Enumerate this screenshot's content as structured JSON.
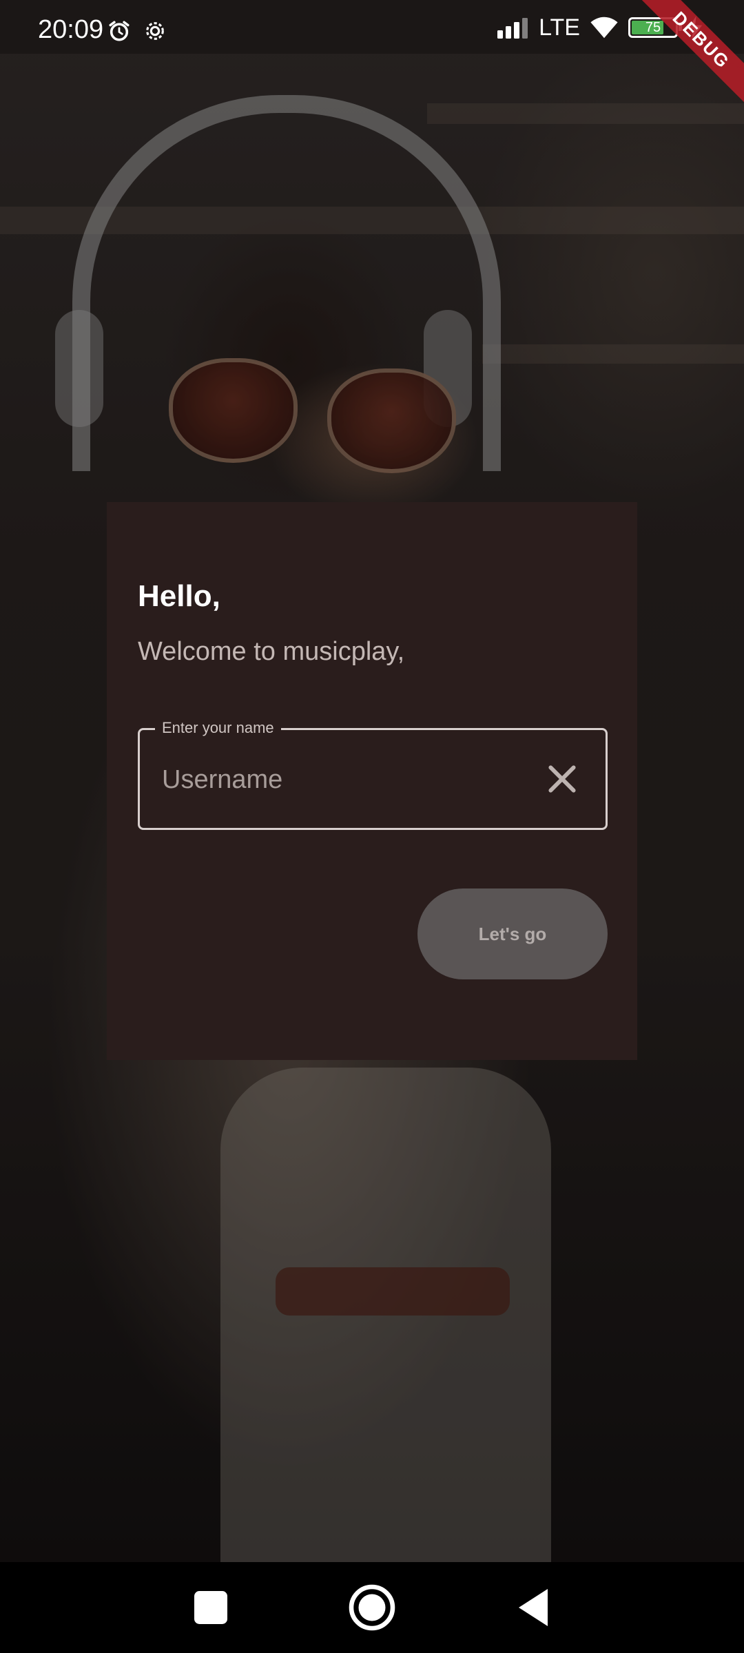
{
  "status_bar": {
    "time": "20:09",
    "network": "LTE",
    "battery_percent": "75",
    "battery_level": 0.75,
    "icons": [
      "alarm-icon",
      "settings-icon",
      "signal-icon",
      "wifi-icon",
      "battery-icon",
      "charging-icon"
    ]
  },
  "debug_banner": "DEBUG",
  "dialog": {
    "title": "Hello,",
    "subtitle": "Welcome to musicplay,",
    "name_field": {
      "label": "Enter your name",
      "placeholder": "Username",
      "value": ""
    },
    "clear_icon": "close-icon",
    "submit_label": "Let's go"
  },
  "nav_bar": {
    "icons": [
      "recents-icon",
      "home-icon",
      "back-icon"
    ]
  },
  "colors": {
    "card_background": "#2a1d1c",
    "button_background": "#5a5555",
    "debug_banner": "#b41e28"
  }
}
